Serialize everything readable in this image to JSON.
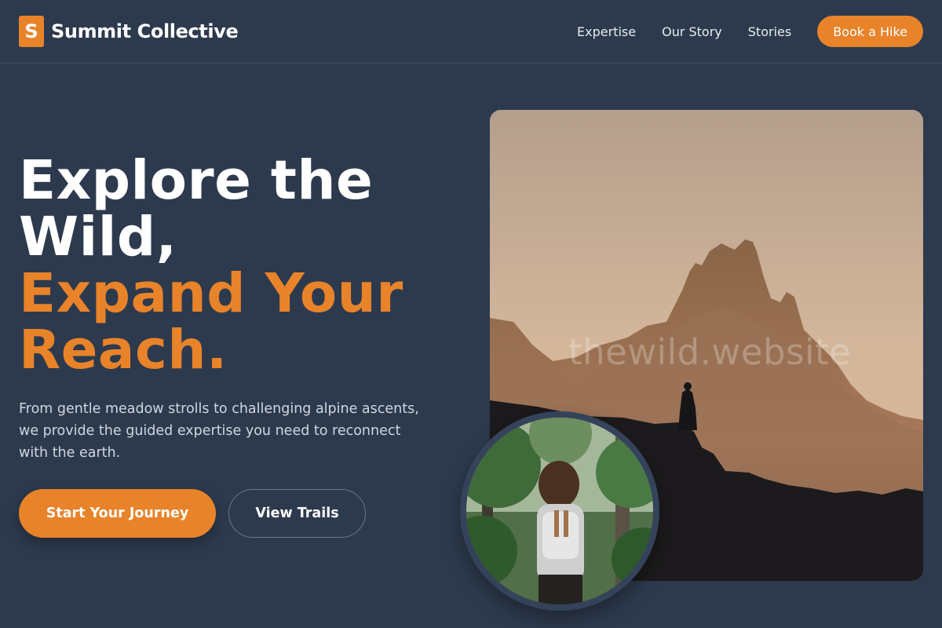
{
  "brand": {
    "logo_letter": "S",
    "name": "Summit Collective",
    "accent_color": "#e8832a"
  },
  "nav": {
    "links": [
      "Expertise",
      "Our Story",
      "Stories"
    ],
    "cta_label": "Book a Hike"
  },
  "hero": {
    "title_line_1": "Explore the",
    "title_line_2": "Wild,",
    "title_line_3": "Expand Your",
    "title_line_4": "Reach.",
    "description": "From gentle meadow strolls to challenging alpine ascents, we provide the guided expertise you need to reconnect with the earth.",
    "primary_button": "Start Your Journey",
    "secondary_button": "View Trails"
  },
  "media": {
    "watermark": "thewild.website"
  }
}
